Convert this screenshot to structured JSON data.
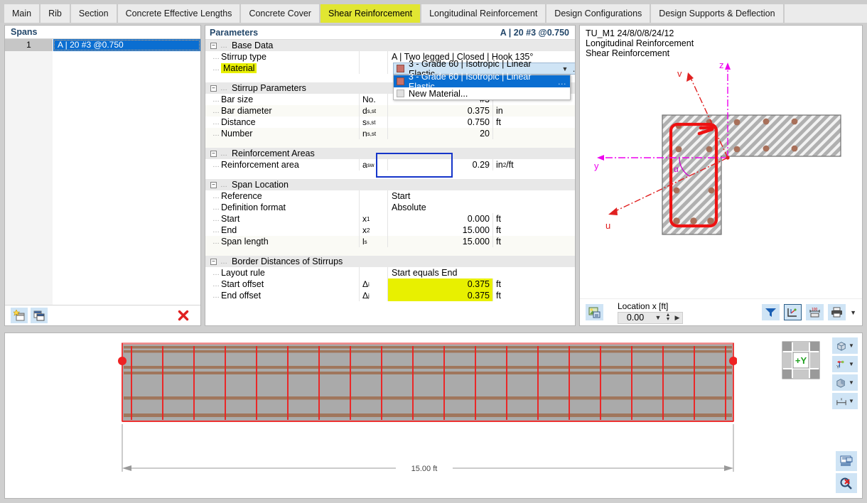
{
  "tabs": [
    {
      "label": "Main",
      "active": false
    },
    {
      "label": "Rib",
      "active": false
    },
    {
      "label": "Section",
      "active": false
    },
    {
      "label": "Concrete Effective Lengths",
      "active": false
    },
    {
      "label": "Concrete Cover",
      "active": false
    },
    {
      "label": "Shear Reinforcement",
      "active": true
    },
    {
      "label": "Longitudinal Reinforcement",
      "active": false
    },
    {
      "label": "Design Configurations",
      "active": false
    },
    {
      "label": "Design Supports & Deflection",
      "active": false
    }
  ],
  "spans": {
    "header": "Spans",
    "rows": [
      {
        "num": "1",
        "label": "A | 20 #3 @0.750"
      }
    ],
    "toolbar": {
      "new_label": "new-span",
      "copy_label": "copy-span",
      "delete_label": "✖"
    }
  },
  "parameters": {
    "header": "Parameters",
    "header_right": "A | 20 #3 @0.750",
    "groups": [
      {
        "title": "Base Data",
        "rows": [
          {
            "label": "Stirrup type",
            "symbol": "",
            "value": "A | Two legged | Closed | Hook 135°",
            "unit": "",
            "align": "left"
          },
          {
            "label": "Material",
            "symbol": "",
            "value": "3 - Grade 60 | Isotropic | Linear Elastic",
            "unit": "",
            "align": "left",
            "label_highlight": true,
            "is_combo": true
          }
        ]
      },
      {
        "title": "Stirrup Parameters",
        "rows": [
          {
            "label": "Bar size",
            "symbol": "No.",
            "value": "#3",
            "unit": ""
          },
          {
            "label": "Bar diameter",
            "symbol": "d",
            "symbol_sub": "s,st",
            "value": "0.375",
            "unit": "in"
          },
          {
            "label": "Distance",
            "symbol": "s",
            "symbol_sub": "s,st",
            "value": "0.750",
            "unit": "ft"
          },
          {
            "label": "Number",
            "symbol": "n",
            "symbol_sub": "s,st",
            "value": "20",
            "unit": ""
          }
        ]
      },
      {
        "title": "Reinforcement Areas",
        "rows": [
          {
            "label": "Reinforcement area",
            "symbol": "a",
            "symbol_sub": "sw",
            "value": "0.29",
            "unit": "in²/ft"
          }
        ]
      },
      {
        "title": "Span Location",
        "rows": [
          {
            "label": "Reference",
            "symbol": "",
            "value": "Start",
            "unit": "",
            "align": "left"
          },
          {
            "label": "Definition format",
            "symbol": "",
            "value": "Absolute",
            "unit": "",
            "align": "left"
          },
          {
            "label": "Start",
            "symbol": "x",
            "symbol_sub": "1",
            "value": "0.000",
            "unit": "ft"
          },
          {
            "label": "End",
            "symbol": "x",
            "symbol_sub": "2",
            "value": "15.000",
            "unit": "ft"
          },
          {
            "label": "Span length",
            "symbol": "l",
            "symbol_sub": "s",
            "value": "15.000",
            "unit": "ft"
          }
        ]
      },
      {
        "title": "Border Distances of Stirrups",
        "rows": [
          {
            "label": "Layout rule",
            "symbol": "",
            "value": "Start equals End",
            "unit": "",
            "align": "left"
          },
          {
            "label": "Start offset",
            "symbol": "Δ",
            "symbol_sub": "i",
            "value": "0.375",
            "unit": "ft",
            "value_highlight": true
          },
          {
            "label": "End offset",
            "symbol": "Δ",
            "symbol_sub": "j",
            "value": "0.375",
            "unit": "ft",
            "value_highlight": true
          }
        ]
      }
    ],
    "material_dropdown": {
      "selected": "3 - Grade 60 | Isotropic | Linear Elastic",
      "options": [
        {
          "label": "3 - Grade 60 | Isotropic | Linear Elastic",
          "selected": true,
          "swatch": "#c8726a"
        },
        {
          "label": "New Material...",
          "selected": false,
          "swatch": "#e0e0e0"
        }
      ]
    },
    "colors": {
      "highlight_yellow": "#e8f000",
      "focus_blue": "#1535c9",
      "select_blue": "#0a6ed1",
      "header_text": "#24486b"
    }
  },
  "view": {
    "title_line1": "TU_M1 24/8/0/8/24/12",
    "title_line2": "Longitudinal Reinforcement",
    "title_line3": "Shear Reinforcement",
    "axes": [
      {
        "name": "z",
        "color": "#ee00ee"
      },
      {
        "name": "y",
        "color": "#ee00ee"
      },
      {
        "name": "v",
        "color": "#e02020"
      },
      {
        "name": "u",
        "color": "#e02020"
      },
      {
        "name": "α",
        "color": "#cc00cc"
      }
    ],
    "location": {
      "label": "Location x [ft]",
      "value": "0.00"
    },
    "buttons": [
      {
        "name": "image-export-button"
      },
      {
        "name": "filter-button"
      },
      {
        "name": "axes-display-button"
      },
      {
        "name": "dimensions-button"
      },
      {
        "name": "print-button"
      }
    ]
  },
  "elevation": {
    "dimension_label": "15.00 ft",
    "stirrup_count": 20,
    "axis_widget_label": "+Y",
    "view_buttons": [
      {
        "name": "render-mode-button"
      },
      {
        "name": "axis-system-button"
      },
      {
        "name": "shading-button"
      },
      {
        "name": "dimension-style-button"
      }
    ],
    "corner_buttons": [
      {
        "name": "print-preview-button"
      },
      {
        "name": "zoom-reset-button"
      }
    ]
  }
}
